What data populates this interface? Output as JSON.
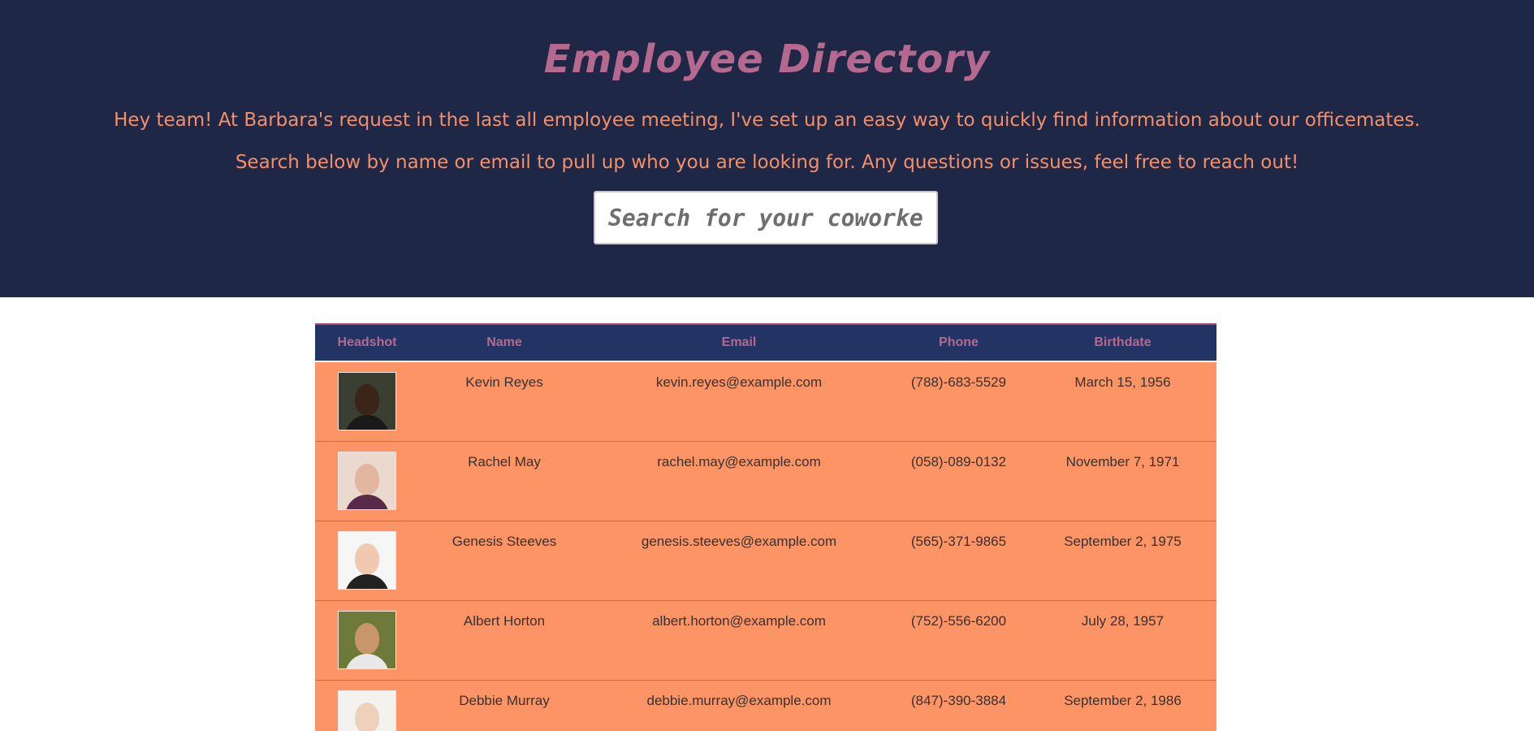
{
  "header": {
    "title": "Employee Directory",
    "intro_line1": "Hey team! At Barbara's request in the last all employee meeting, I've set up an easy way to quickly find information about our officemates.",
    "intro_line2": "Search below by name or email to pull up who you are looking for. Any questions or issues, feel free to reach out!"
  },
  "search": {
    "placeholder": "Search for your coworker here",
    "value": ""
  },
  "table": {
    "columns": [
      "Headshot",
      "Name",
      "Email",
      "Phone",
      "Birthdate"
    ],
    "rows": [
      {
        "name": "Kevin Reyes",
        "email": "kevin.reyes@example.com",
        "phone": "(788)-683-5529",
        "birthdate": "March 15, 1956",
        "headshot": {
          "bg": "#3a3f32",
          "skin": "#3b2418",
          "shirt": "#1a1a1a"
        }
      },
      {
        "name": "Rachel May",
        "email": "rachel.may@example.com",
        "phone": "(058)-089-0132",
        "birthdate": "November 7, 1971",
        "headshot": {
          "bg": "#e9d9cf",
          "skin": "#e2b6a0",
          "shirt": "#5a2a4a"
        }
      },
      {
        "name": "Genesis Steeves",
        "email": "genesis.steeves@example.com",
        "phone": "(565)-371-9865",
        "birthdate": "September 2, 1975",
        "headshot": {
          "bg": "#f6f6f6",
          "skin": "#f0c9b0",
          "shirt": "#222222"
        }
      },
      {
        "name": "Albert Horton",
        "email": "albert.horton@example.com",
        "phone": "(752)-556-6200",
        "birthdate": "July 28, 1957",
        "headshot": {
          "bg": "#6d7a3a",
          "skin": "#c9956b",
          "shirt": "#e8e8e8"
        }
      },
      {
        "name": "Debbie Murray",
        "email": "debbie.murray@example.com",
        "phone": "(847)-390-3884",
        "birthdate": "September 2, 1986",
        "headshot": {
          "bg": "#f4f2ef",
          "skin": "#efd0bb",
          "shirt": "#7a4b36"
        }
      }
    ]
  }
}
